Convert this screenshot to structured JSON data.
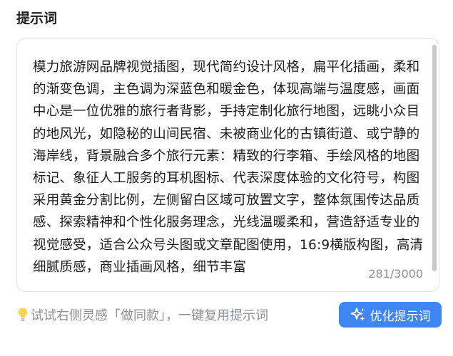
{
  "section_title": "提示词",
  "prompt": {
    "text": "模力旅游网品牌视觉插图，现代简约设计风格，扁平化插画，柔和的渐变色调，主色调为深蓝色和暖金色，体现高端与温度感，画面中心是一位优雅的旅行者背影，手持定制化旅行地图，远眺小众目的地风光，如隐秘的山间民宿、未被商业化的古镇街道、或宁静的海岸线，背景融合多个旅行元素：精致的行李箱、手绘风格的地图标记、象征人工服务的耳机图标、代表深度体验的文化符号，构图采用黄金分割比例，左侧留白区域可放置文字，整体氛围传达品质感、探索精神和个性化服务理念，光线温暖柔和，营造舒适专业的视觉感受，适合公众号头图或文章配图使用，16:9横版构图，高清细腻质感，商业插画风格，细节丰富",
    "char_count": "281/3000"
  },
  "hint": {
    "icon": "lightbulb-icon",
    "text": "试试右侧灵感「做同款」，一键复用提示词"
  },
  "optimize_button": {
    "icon": "sparkle-icon",
    "label": "优化提示词",
    "color": "#3f86f5"
  }
}
